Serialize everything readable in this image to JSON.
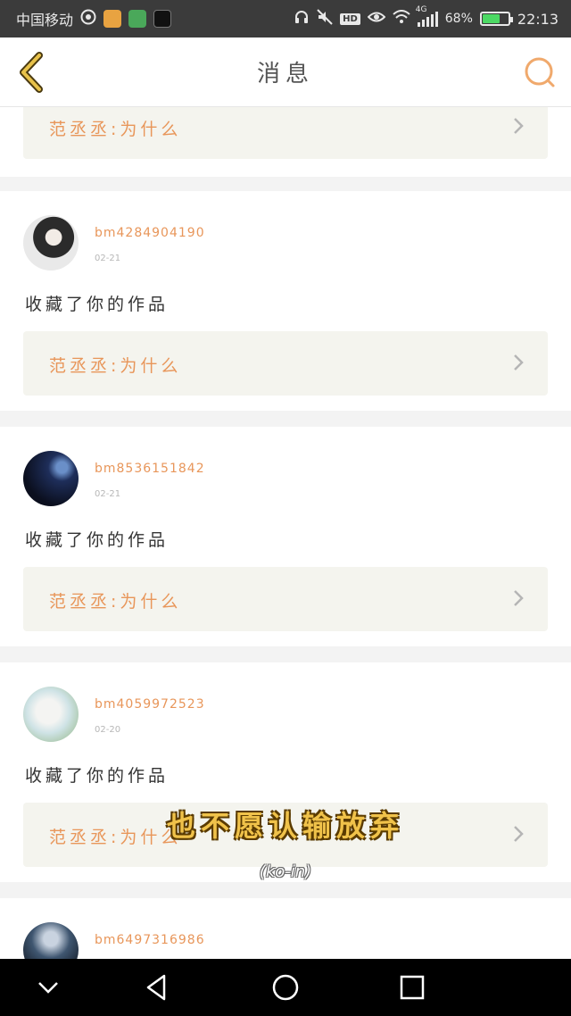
{
  "status_bar": {
    "carrier": "中国移动",
    "network": "4G",
    "battery_percent": "68%",
    "battery_level": 0.68,
    "time": "22:13",
    "hd_label": "HD",
    "icons": [
      "hotspot-icon",
      "weibo-icon",
      "tencent-video-icon",
      "tiktok-icon",
      "headphones-icon",
      "mute-icon",
      "eye-icon",
      "wifi-icon",
      "signal-icon",
      "battery-icon"
    ]
  },
  "header": {
    "title": "消息",
    "back_icon": "chevron-left-icon",
    "search_icon": "search-icon",
    "accent_color": "#e8b84a"
  },
  "quote_text": "范丞丞:为什么",
  "notifications": [
    {
      "username": "bm4284904190",
      "date": "02-21",
      "action": "收藏了你的作品",
      "quote": "范丞丞:为什么"
    },
    {
      "username": "bm8536151842",
      "date": "02-21",
      "action": "收藏了你的作品",
      "quote": "范丞丞:为什么"
    },
    {
      "username": "bm4059972523",
      "date": "02-20",
      "action": "收藏了你的作品",
      "quote": "范丞丞:为什么"
    },
    {
      "username": "bm6497316986"
    }
  ],
  "overlay": {
    "subtitle": "也不愿认输放弃",
    "credit": "(ko-in)"
  },
  "colors": {
    "username": "#e8965a",
    "quote_text": "#e8965a",
    "quote_bg": "#f4f4ee",
    "separator": "#f3f3f3"
  }
}
